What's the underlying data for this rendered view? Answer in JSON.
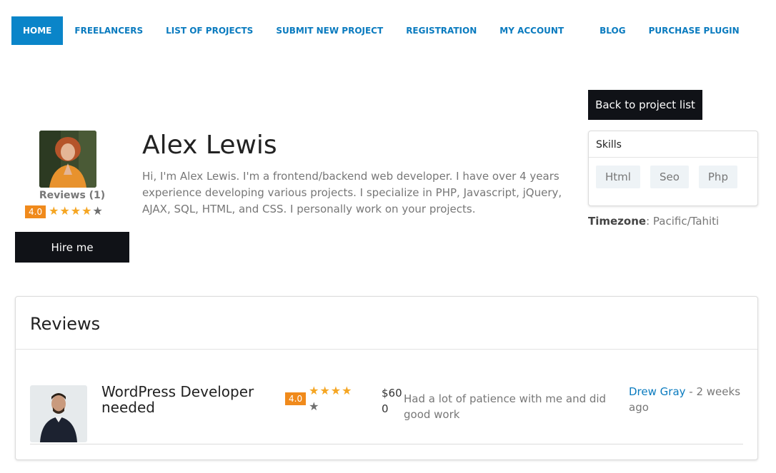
{
  "nav": {
    "items": [
      {
        "label": "HOME",
        "active": true
      },
      {
        "label": "FREELANCERS"
      },
      {
        "label": "LIST OF PROJECTS"
      },
      {
        "label": "SUBMIT NEW PROJECT"
      },
      {
        "label": "REGISTRATION"
      },
      {
        "label": "MY ACCOUNT"
      },
      {
        "label": "BLOG"
      },
      {
        "label": "PURCHASE PLUGIN"
      }
    ]
  },
  "profile": {
    "name": "Alex Lewis",
    "bio": "Hi, I'm Alex Lewis. I'm a frontend/backend web developer. I have over 4 years experience developing various projects. I specialize in PHP, Javascript, jQuery, AJAX, SQL, HTML, and CSS. I personally work on your projects.",
    "reviews_label": "Reviews (1)",
    "rating": "4.0",
    "stars_filled": 4,
    "stars_total": 5,
    "hire_label": "Hire me"
  },
  "sidebar": {
    "back_label": "Back to project list",
    "skills_title": "Skills",
    "skills": [
      "Html",
      "Seo",
      "Php"
    ],
    "timezone_label": "Timezone",
    "timezone_value": "Pacific/Tahiti"
  },
  "reviews": {
    "heading": "Reviews",
    "items": [
      {
        "title": "WordPress Developer needed",
        "rating": "4.0",
        "stars_filled": 4,
        "amount": "$600",
        "comment": "Had a lot of patience with me and did good work",
        "author": "Drew Gray",
        "time": "2 weeks ago"
      }
    ]
  },
  "colors": {
    "accent": "#0a85c9",
    "link": "#0a7bbf",
    "badge": "#f08a1c",
    "star": "#f5a623",
    "dark_button": "#101217"
  }
}
